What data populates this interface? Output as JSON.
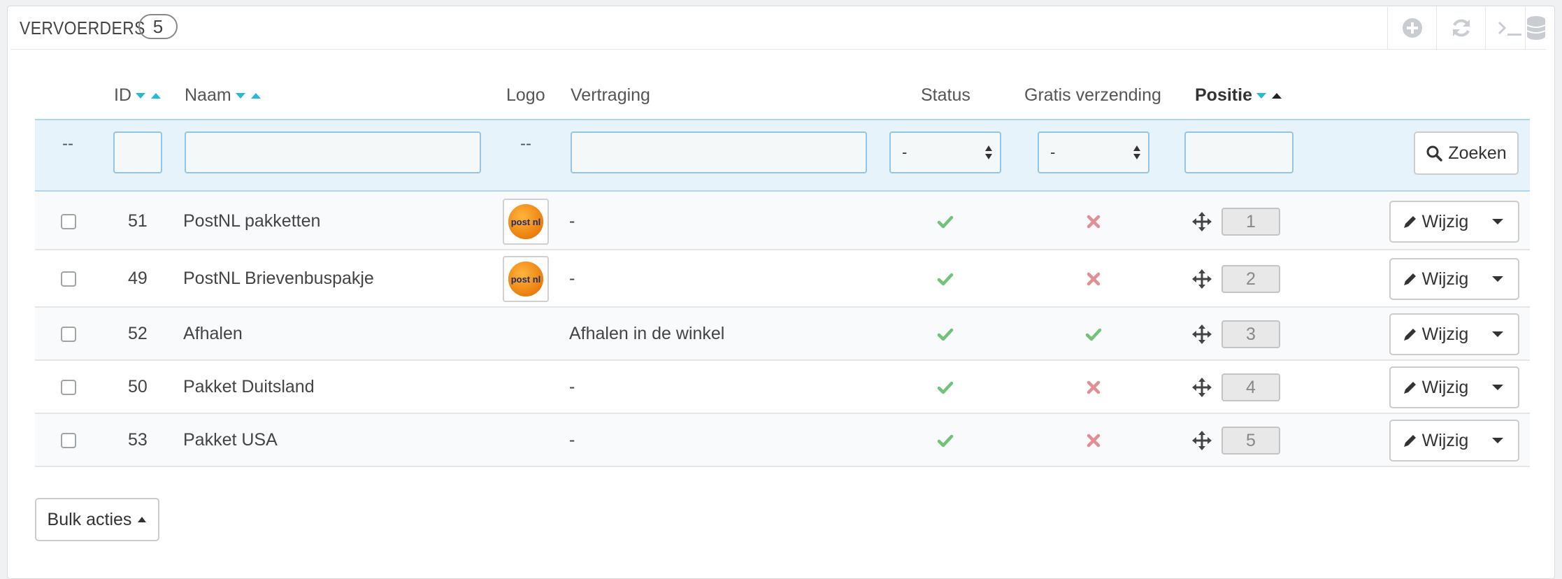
{
  "panel": {
    "title": "VERVOERDERS",
    "count": "5",
    "toolbar_icons": [
      "add-new-icon",
      "refresh-icon",
      "sql-query-icon",
      "export-database-icon"
    ]
  },
  "columns": {
    "id": "ID",
    "name": "Naam",
    "logo": "Logo",
    "delay": "Vertraging",
    "status": "Status",
    "free_shipping": "Gratis verzending",
    "position": "Positie"
  },
  "filters": {
    "id_dash": "--",
    "logo_dash": "--",
    "status_value": "-",
    "free_value": "-",
    "search_label": "Zoeken"
  },
  "rows": [
    {
      "id": "51",
      "name": "PostNL pakketten",
      "has_logo": true,
      "delay": "-",
      "status": true,
      "free": false,
      "position": "1",
      "edit": "Wijzig"
    },
    {
      "id": "49",
      "name": "PostNL Brievenbuspakje",
      "has_logo": true,
      "delay": "-",
      "status": true,
      "free": false,
      "position": "2",
      "edit": "Wijzig"
    },
    {
      "id": "52",
      "name": "Afhalen",
      "has_logo": false,
      "delay": "Afhalen in de winkel",
      "status": true,
      "free": true,
      "position": "3",
      "edit": "Wijzig"
    },
    {
      "id": "50",
      "name": "Pakket Duitsland",
      "has_logo": false,
      "delay": "-",
      "status": true,
      "free": false,
      "position": "4",
      "edit": "Wijzig"
    },
    {
      "id": "53",
      "name": "Pakket USA",
      "has_logo": false,
      "delay": "-",
      "status": true,
      "free": false,
      "position": "5",
      "edit": "Wijzig"
    }
  ],
  "logo_text": "post nl",
  "bulk_label": "Bulk acties",
  "colors": {
    "check_green": "#72c279",
    "cross_red": "#e08f95",
    "sort_blue": "#25b9d7",
    "filter_bg": "#e7f3fb"
  }
}
